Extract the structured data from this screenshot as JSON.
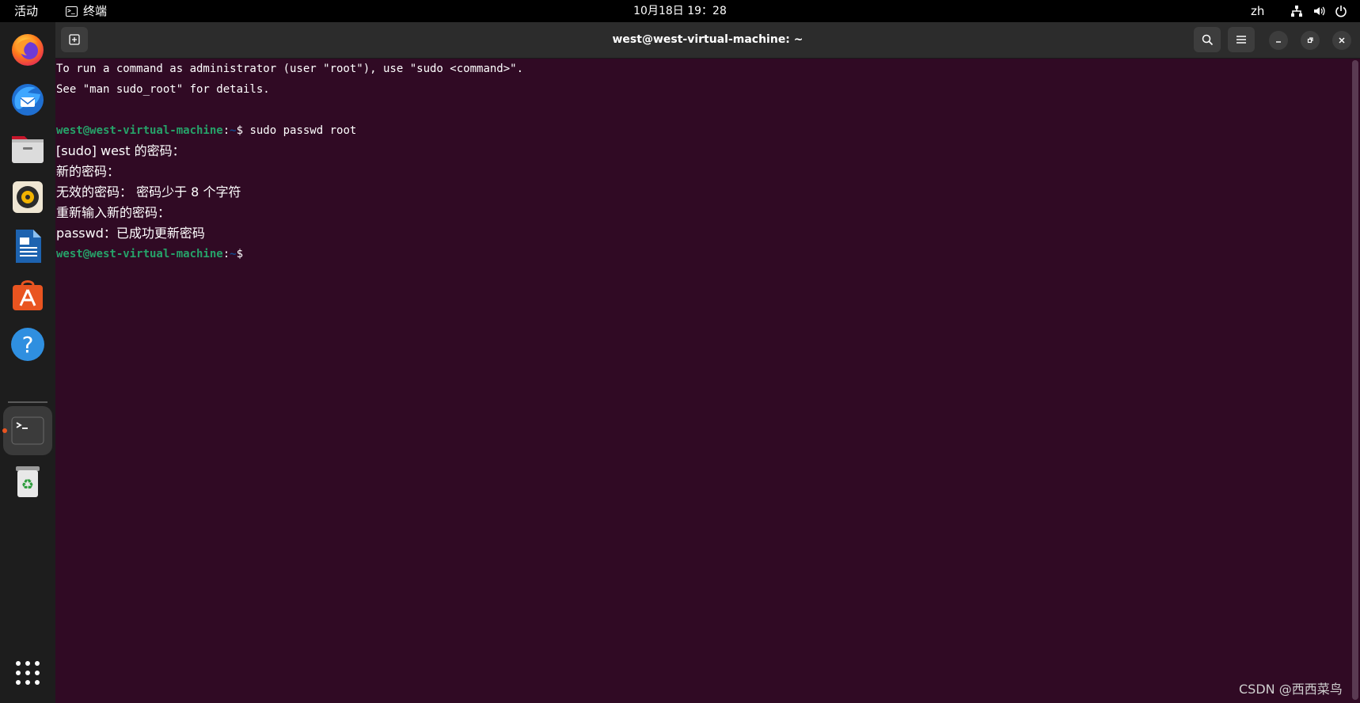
{
  "topbar": {
    "activities": "活动",
    "app_name": "终端",
    "clock": "10月18日 19：28",
    "lang": "zh",
    "tray_icons": [
      "network-icon",
      "volume-icon",
      "power-icon"
    ]
  },
  "dock": {
    "apps": [
      {
        "name": "firefox",
        "icon": "firefox-icon"
      },
      {
        "name": "thunderbird",
        "icon": "thunderbird-icon"
      },
      {
        "name": "files",
        "icon": "files-icon"
      },
      {
        "name": "rhythmbox",
        "icon": "rhythmbox-icon"
      },
      {
        "name": "libreoffice-writer",
        "icon": "writer-icon"
      },
      {
        "name": "app-center",
        "icon": "app-center-icon"
      },
      {
        "name": "help",
        "icon": "help-icon"
      },
      {
        "name": "terminal",
        "icon": "terminal-icon",
        "active": true
      },
      {
        "name": "trash",
        "icon": "trash-icon"
      }
    ],
    "show_apps": "grid-icon",
    "accent": "#e95420"
  },
  "window": {
    "title": "west@west-virtual-machine: ~"
  },
  "terminal": {
    "background": "#300a24",
    "prompt_user_color": "#26a269",
    "prompt_path_color": "#12488b",
    "lines": {
      "l1": "To run a command as administrator (user \"root\"), use \"sudo <command>\".",
      "l2": "See \"man sudo_root\" for details.",
      "prompt1_user": "west@west-virtual-machine",
      "prompt1_sep": ":",
      "prompt1_path": "~",
      "prompt1_cmd": "$ sudo passwd root",
      "l4": "[sudo] west 的密码：",
      "l5": "新的密码：",
      "l6": "无效的密码： 密码少于 8 个字符",
      "l7": "重新输入新的密码：",
      "l8": "passwd：已成功更新密码",
      "prompt2_user": "west@west-virtual-machine",
      "prompt2_sep": ":",
      "prompt2_path": "~",
      "prompt2_cmd": "$"
    }
  },
  "watermark": "CSDN @西西菜鸟"
}
